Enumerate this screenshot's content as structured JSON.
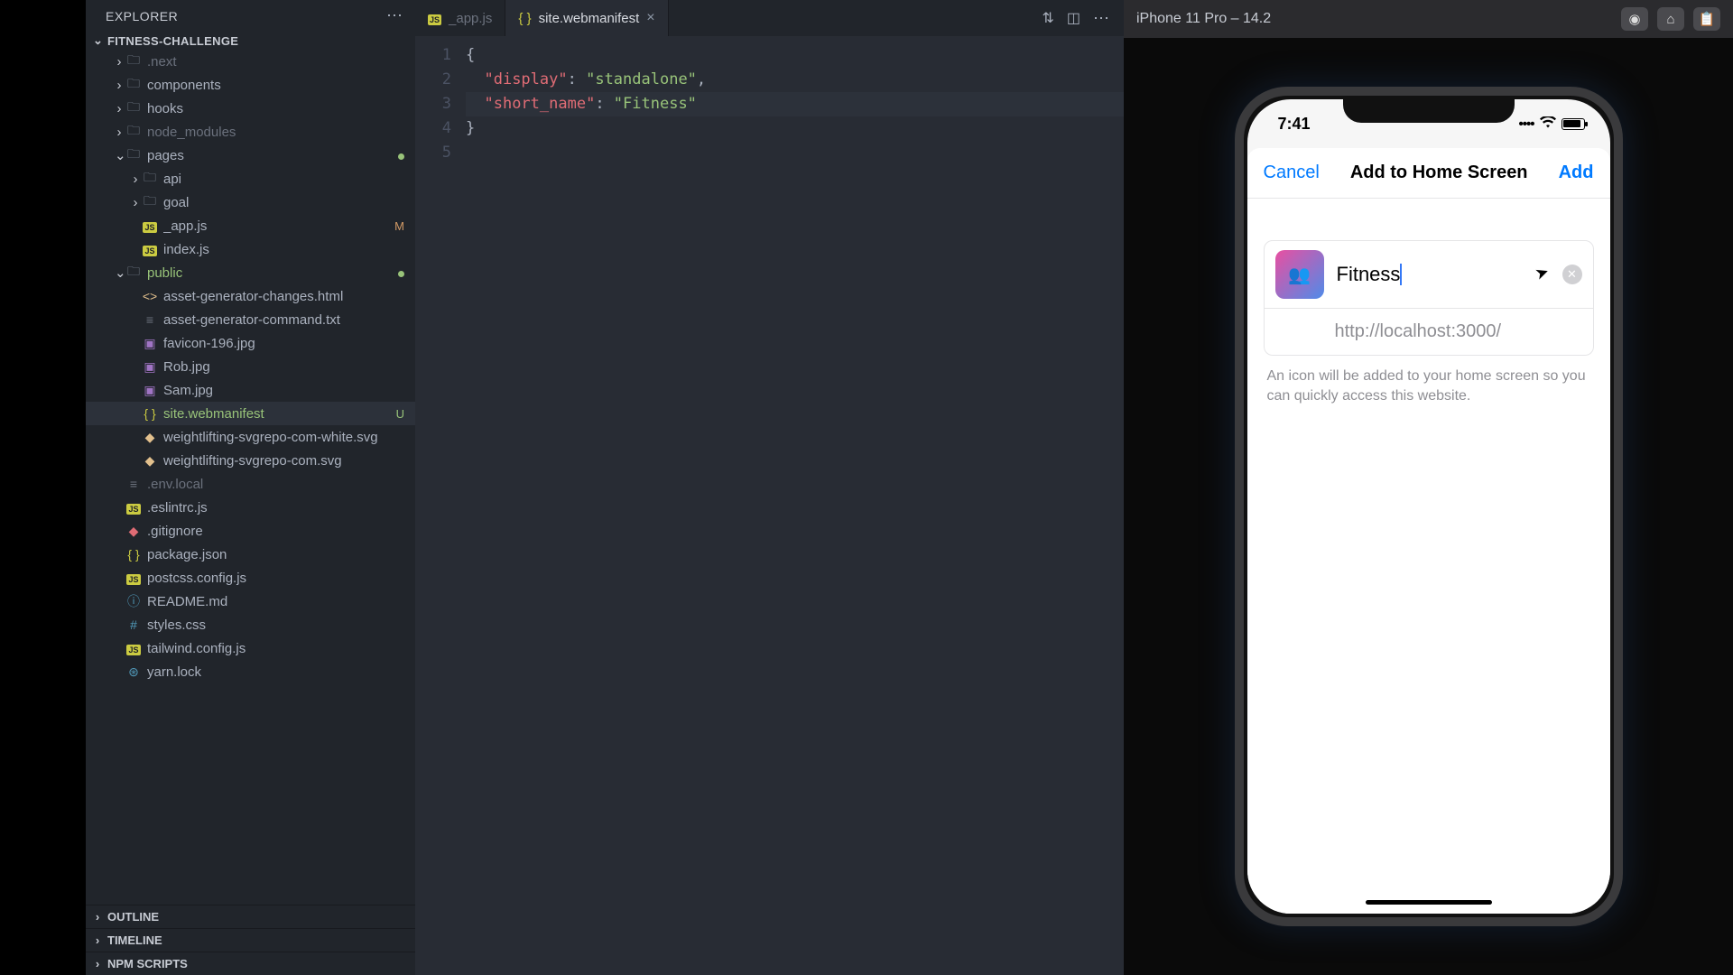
{
  "explorer": {
    "title": "EXPLORER",
    "project": "FITNESS-CHALLENGE",
    "sections": {
      "outline": "OUTLINE",
      "timeline": "TIMELINE",
      "npm": "NPM SCRIPTS"
    },
    "tree": [
      {
        "depth": 1,
        "type": "folder",
        "collapsed": true,
        "label": ".next",
        "dim": true
      },
      {
        "depth": 1,
        "type": "folder",
        "collapsed": true,
        "label": "components"
      },
      {
        "depth": 1,
        "type": "folder",
        "collapsed": true,
        "label": "hooks"
      },
      {
        "depth": 1,
        "type": "folder",
        "collapsed": true,
        "label": "node_modules",
        "dim": true
      },
      {
        "depth": 1,
        "type": "folder",
        "collapsed": false,
        "label": "pages",
        "dot": "green"
      },
      {
        "depth": 2,
        "type": "folder",
        "collapsed": true,
        "label": "api"
      },
      {
        "depth": 2,
        "type": "folder",
        "collapsed": true,
        "label": "goal"
      },
      {
        "depth": 2,
        "type": "file",
        "icon": "js",
        "label": "_app.js",
        "badge": "M",
        "badgeClass": "yellow-badge"
      },
      {
        "depth": 2,
        "type": "file",
        "icon": "js",
        "label": "index.js"
      },
      {
        "depth": 1,
        "type": "folder",
        "collapsed": false,
        "label": "public",
        "green": true,
        "dot": "green"
      },
      {
        "depth": 2,
        "type": "file",
        "icon": "html",
        "label": "asset-generator-changes.html"
      },
      {
        "depth": 2,
        "type": "file",
        "icon": "txt",
        "label": "asset-generator-command.txt"
      },
      {
        "depth": 2,
        "type": "file",
        "icon": "img",
        "label": "favicon-196.jpg"
      },
      {
        "depth": 2,
        "type": "file",
        "icon": "img",
        "label": "Rob.jpg"
      },
      {
        "depth": 2,
        "type": "file",
        "icon": "img",
        "label": "Sam.jpg"
      },
      {
        "depth": 2,
        "type": "file",
        "icon": "json",
        "label": "site.webmanifest",
        "selected": true,
        "green": true,
        "badge": "U",
        "badgeClass": "green"
      },
      {
        "depth": 2,
        "type": "file",
        "icon": "svg",
        "label": "weightlifting-svgrepo-com-white.svg"
      },
      {
        "depth": 2,
        "type": "file",
        "icon": "svg",
        "label": "weightlifting-svgrepo-com.svg"
      },
      {
        "depth": 1,
        "type": "file",
        "icon": "txt",
        "label": ".env.local",
        "dim": true
      },
      {
        "depth": 1,
        "type": "file",
        "icon": "js",
        "label": ".eslintrc.js"
      },
      {
        "depth": 1,
        "type": "file",
        "icon": "git",
        "label": ".gitignore"
      },
      {
        "depth": 1,
        "type": "file",
        "icon": "json",
        "label": "package.json"
      },
      {
        "depth": 1,
        "type": "file",
        "icon": "js",
        "label": "postcss.config.js"
      },
      {
        "depth": 1,
        "type": "file",
        "icon": "md",
        "label": "README.md"
      },
      {
        "depth": 1,
        "type": "file",
        "icon": "css",
        "label": "styles.css"
      },
      {
        "depth": 1,
        "type": "file",
        "icon": "js",
        "label": "tailwind.config.js"
      },
      {
        "depth": 1,
        "type": "file",
        "icon": "yarn",
        "label": "yarn.lock"
      }
    ]
  },
  "tabs": [
    {
      "label": "_app.js",
      "icon": "js",
      "active": false
    },
    {
      "label": "site.webmanifest",
      "icon": "json",
      "active": true
    }
  ],
  "code": {
    "lines": [
      "1",
      "2",
      "3",
      "4",
      "5"
    ],
    "line1": "{",
    "line2_key": "\"display\"",
    "line2_val": "\"standalone\"",
    "line3_key": "\"short_name\"",
    "line3_val": "\"Fitness\"",
    "line4": "}"
  },
  "simulator": {
    "device": "iPhone 11 Pro – 14.2",
    "time": "7:41",
    "sheet": {
      "cancel": "Cancel",
      "title": "Add to Home Screen",
      "add": "Add",
      "appName": "Fitness",
      "url": "http://localhost:3000/",
      "help": "An icon will be added to your home screen so you can quickly access this website."
    }
  }
}
